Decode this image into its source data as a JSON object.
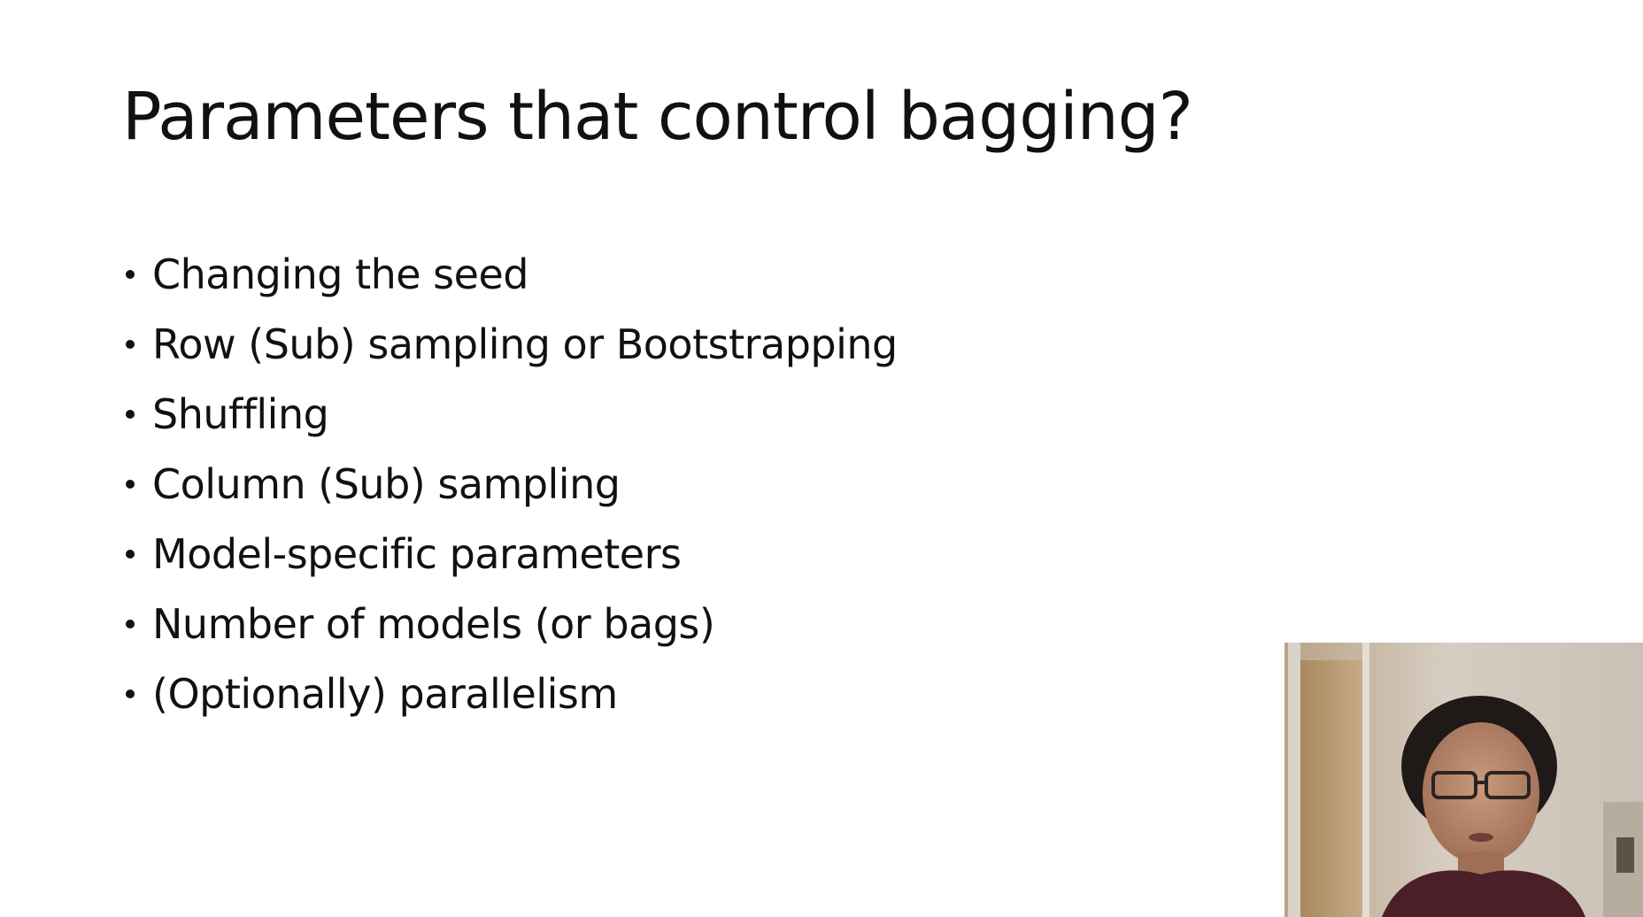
{
  "slide": {
    "title": "Parameters that control bagging?",
    "bullets": [
      "Changing the seed",
      "Row (Sub) sampling or Bootstrapping",
      "Shuffling",
      "Column (Sub) sampling",
      "Model-specific parameters",
      "Number of models (or bags)",
      "(Optionally) parallelism"
    ]
  },
  "webcam": {
    "icon": "presenter-video"
  }
}
